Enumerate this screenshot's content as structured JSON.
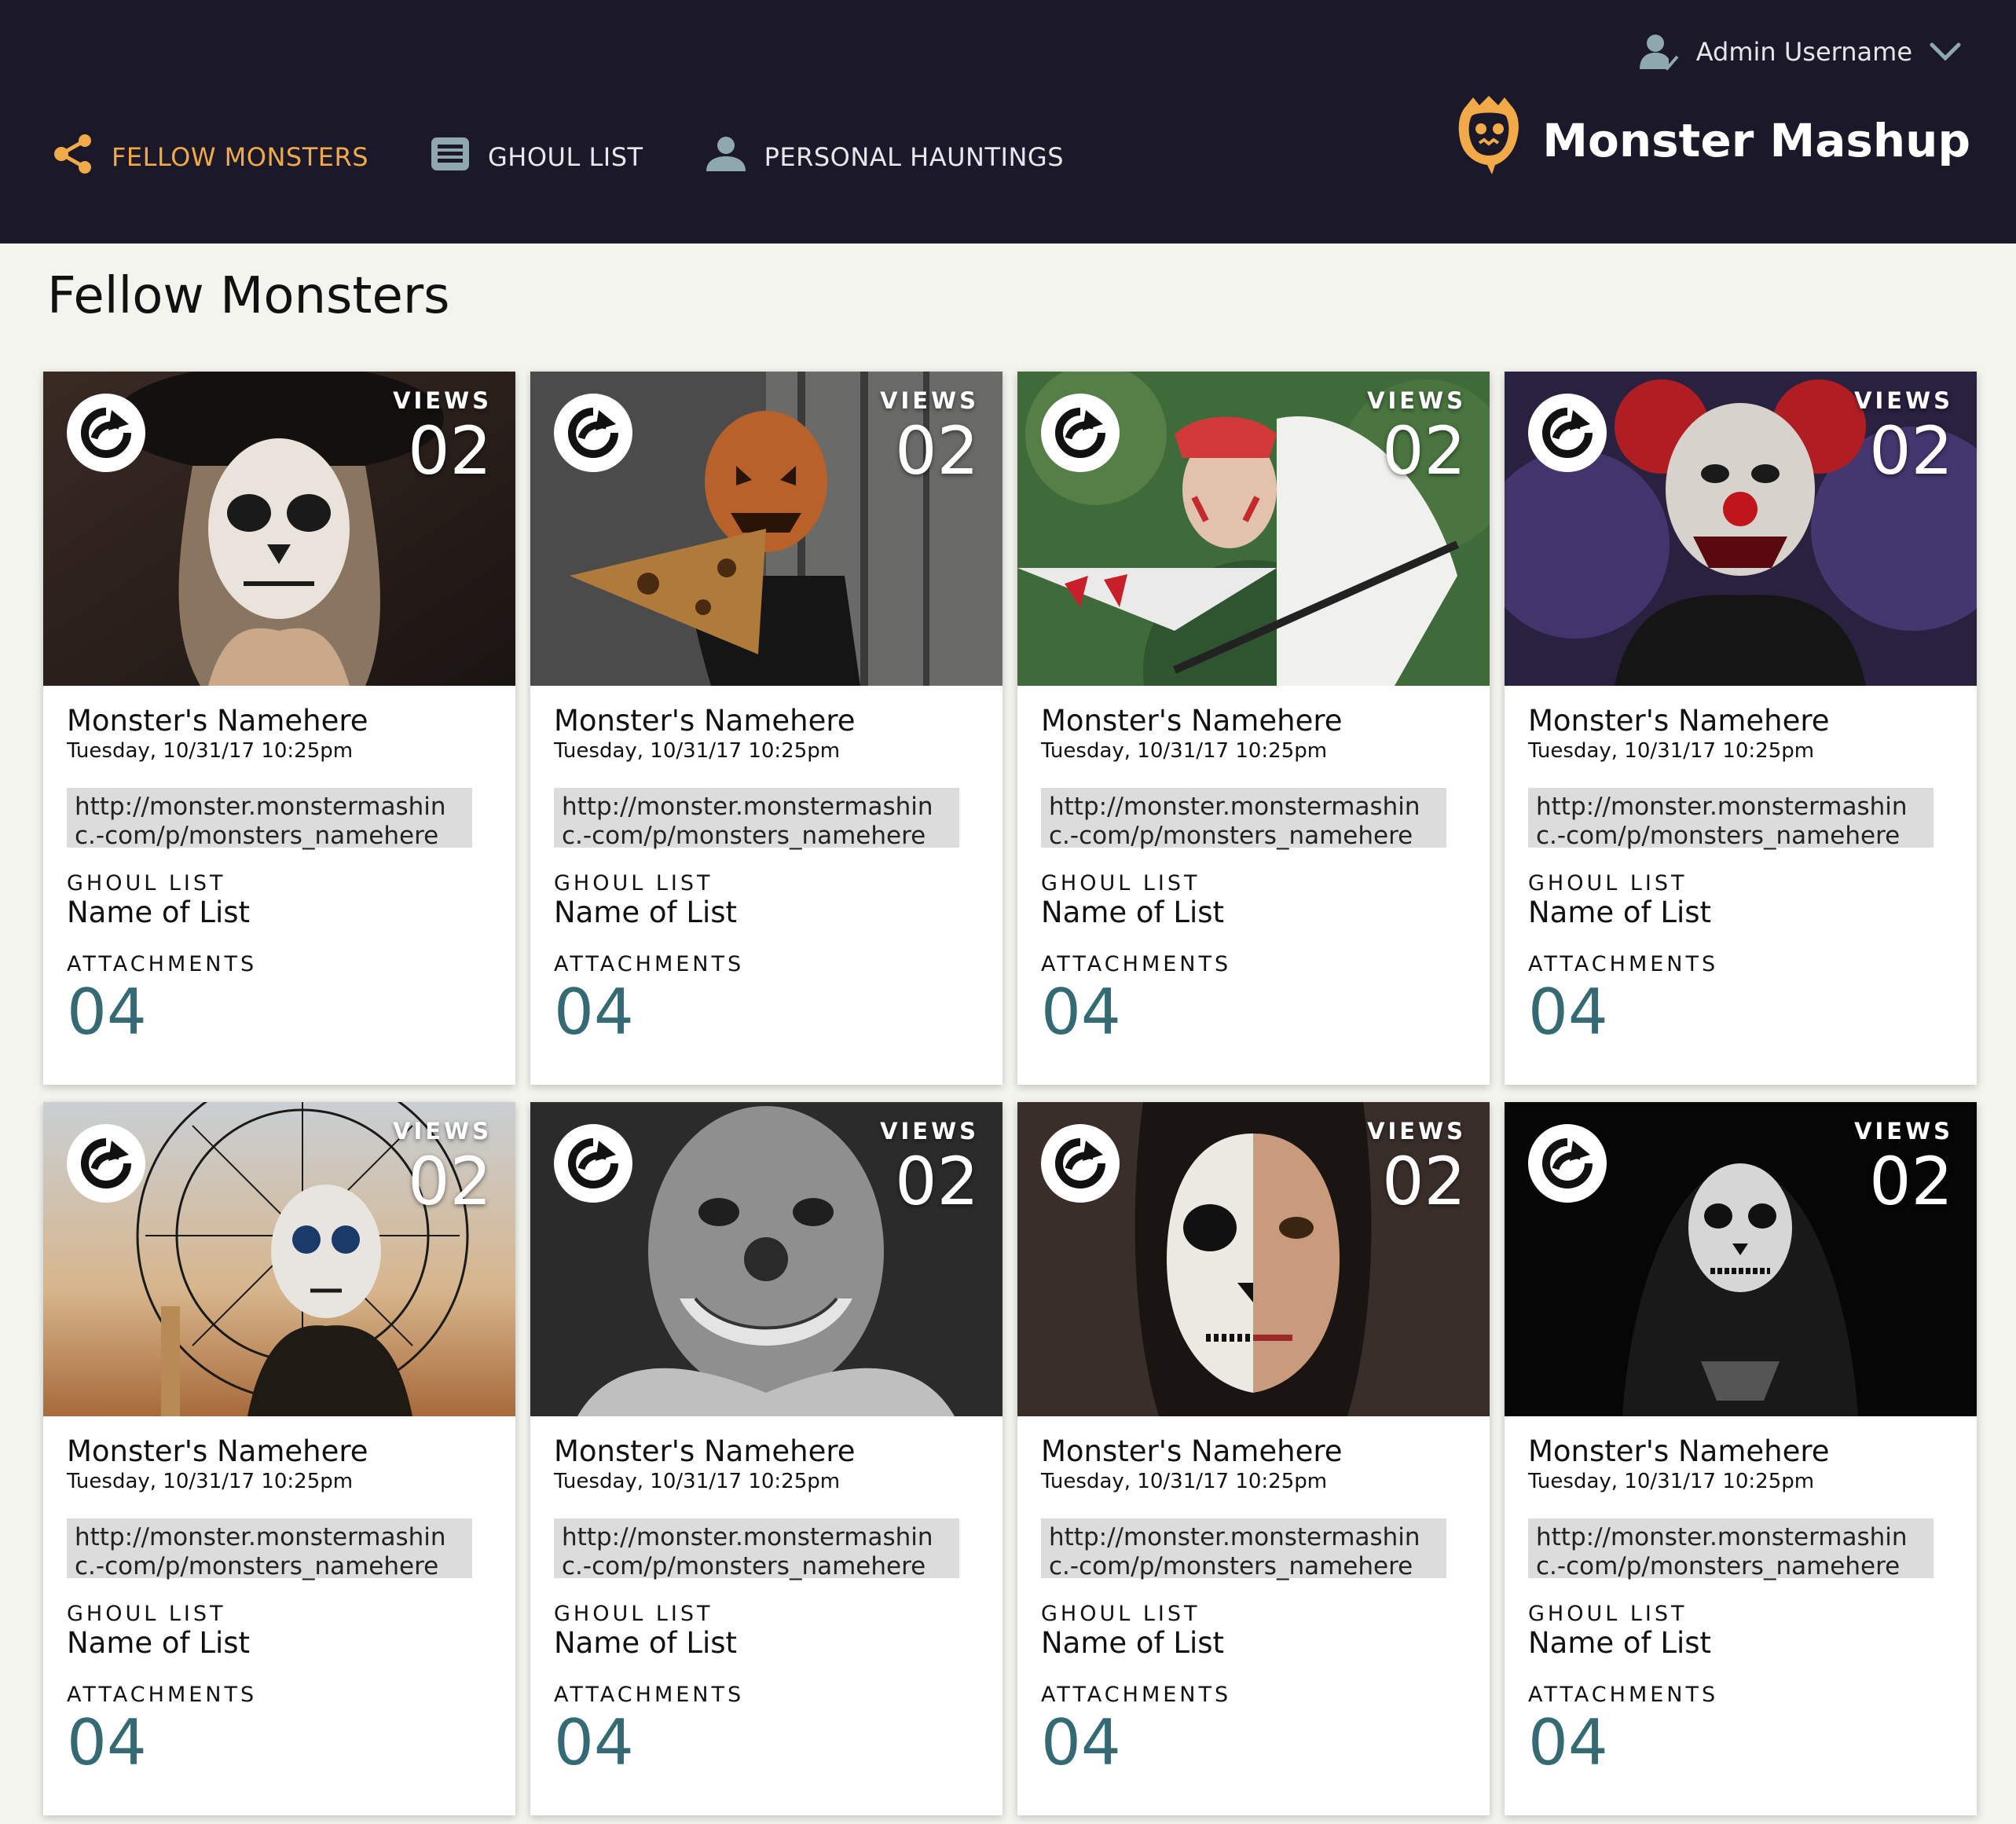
{
  "header": {
    "user": {
      "name": "Admin Username",
      "icon": "user-check-icon"
    },
    "nav": [
      {
        "label": "FELLOW MONSTERS",
        "icon": "share-icon",
        "active": true
      },
      {
        "label": "GHOUL LIST",
        "icon": "list-icon",
        "active": false
      },
      {
        "label": "PERSONAL HAUNTINGS",
        "icon": "person-icon",
        "active": false
      }
    ],
    "brand": {
      "name": "Monster Mashup",
      "logo": "monster-face-logo"
    }
  },
  "page": {
    "title": "Fellow Monsters"
  },
  "labels": {
    "views": "VIEWS",
    "ghoul_list": "GHOUL LIST",
    "attachments": "ATTACHMENTS"
  },
  "cards": [
    {
      "name": "Monster's Namehere",
      "date": "Tuesday, 10/31/17 10:25pm",
      "url": "http://monster.monstermashinc.-com/p/monsters_namehere",
      "views": "02",
      "list_name": "Name of List",
      "attachments": "04",
      "image": "sugar-skull-woman-in-hat"
    },
    {
      "name": "Monster's Namehere",
      "date": "Tuesday, 10/31/17 10:25pm",
      "url": "http://monster.monstermashinc.-com/p/monsters_namehere",
      "views": "02",
      "list_name": "Name of List",
      "attachments": "04",
      "image": "pumpkin-head-holding-pizza"
    },
    {
      "name": "Monster's Namehere",
      "date": "Tuesday, 10/31/17 10:25pm",
      "url": "http://monster.monstermashinc.-com/p/monsters_namehere",
      "views": "02",
      "list_name": "Name of List",
      "attachments": "04",
      "image": "mononoke-cosplay-with-spear"
    },
    {
      "name": "Monster's Namehere",
      "date": "Tuesday, 10/31/17 10:25pm",
      "url": "http://monster.monstermashinc.-com/p/monsters_namehere",
      "views": "02",
      "list_name": "Name of List",
      "attachments": "04",
      "image": "clown-in-purple-smoke"
    },
    {
      "name": "Monster's Namehere",
      "date": "Tuesday, 10/31/17 10:25pm",
      "url": "http://monster.monstermashinc.-com/p/monsters_namehere",
      "views": "02",
      "list_name": "Name of List",
      "attachments": "04",
      "image": "catrina-with-lace-umbrella"
    },
    {
      "name": "Monster's Namehere",
      "date": "Tuesday, 10/31/17 10:25pm",
      "url": "http://monster.monstermashinc.-com/p/monsters_namehere",
      "views": "02",
      "list_name": "Name of List",
      "attachments": "04",
      "image": "grinning-clown-mask-bw"
    },
    {
      "name": "Monster's Namehere",
      "date": "Tuesday, 10/31/17 10:25pm",
      "url": "http://monster.monstermashinc.-com/p/monsters_namehere",
      "views": "02",
      "list_name": "Name of List",
      "attachments": "04",
      "image": "half-skull-face-paint"
    },
    {
      "name": "Monster's Namehere",
      "date": "Tuesday, 10/31/17 10:25pm",
      "url": "http://monster.monstermashinc.-com/p/monsters_namehere",
      "views": "02",
      "list_name": "Name of List",
      "attachments": "04",
      "image": "skull-hoodie-in-dark"
    }
  ]
}
